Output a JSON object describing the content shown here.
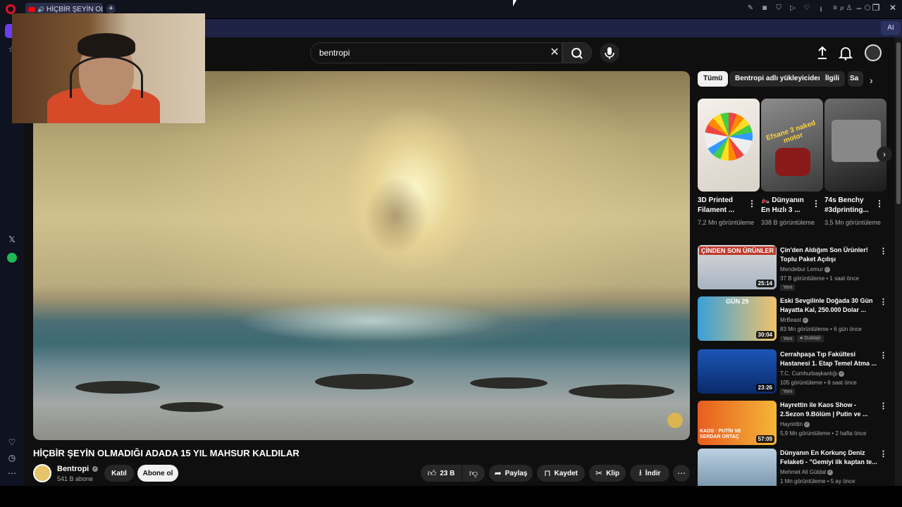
{
  "browser": {
    "tab_title": "HİÇBİR ŞEYİN OLMADI",
    "new_tab_icon": "plus-icon",
    "ai_label": "AI"
  },
  "search": {
    "value": "bentropi"
  },
  "video": {
    "title": "HİÇBİR ŞEYİN OLMADIĞI ADADA 15 YIL MAHSUR KALDILAR",
    "channel_name": "Bentropi",
    "subscribers": "541 B abone",
    "join_label": "Katıl",
    "subscribe_label": "Abone ol",
    "likes": "23 B",
    "share_label": "Paylaş",
    "save_label": "Kaydet",
    "clip_label": "Klip",
    "download_label": "İndir"
  },
  "chips": [
    "Tümü",
    "Bentropi adlı yükleyiciden",
    "İlgili",
    "Sa"
  ],
  "shorts": [
    {
      "title": "3D Printed Filament ...",
      "views": "7,2 Mn görüntüleme"
    },
    {
      "title": "🏍️ Dünyanın En Hızlı 3 ...",
      "views": "338 B görüntüleme"
    },
    {
      "title": "74s Benchy #3dprinting...",
      "views": "3,5 Mn görüntüleme"
    }
  ],
  "shorts_thumb_text": {
    "1": "Efsane 3 naked motor"
  },
  "recommendations": [
    {
      "title": "Çin'den Aldığım Son Ürünler! Toplu Paket Açılışı",
      "channel": "Mendebur Lemur",
      "meta": "37 B görüntüleme • 1 saat önce",
      "duration": "25:14",
      "badge": "Yeni",
      "thumb_text": "ÇİNDEN SON ÜRÜNLER"
    },
    {
      "title": "Eski Sevgilinle Doğada 30 Gün Hayatta Kal, 250.000 Dolar ...",
      "channel": "MrBeast",
      "meta": "83 Mn görüntüleme • 6 gün önce",
      "duration": "30:04",
      "badge": "Yeni",
      "badge2": "Dublajlı",
      "thumb_text": "GÜN 29"
    },
    {
      "title": "Cerrahpaşa Tıp Fakültesi Hastanesi 1. Etap Temel Atma ...",
      "channel": "T.C. Cumhurbaşkanlığı",
      "meta": "105 görüntüleme • 8 saat önce",
      "duration": "23:26",
      "badge": "Yeni",
      "thumb_text": ""
    },
    {
      "title": "Hayrettin ile Kaos Show - 2.Sezon 9.Bölüm | Putin ve ...",
      "channel": "Hayrettin",
      "meta": "5,9 Mn görüntüleme • 2 hafta önce",
      "duration": "57:09",
      "thumb_text": "KAOS · PUTİN VE SERDAR ORTAÇ"
    },
    {
      "title": "Dünyanın En Korkunç Deniz Felaketi - \"Gemiyi ilk kaptan te...",
      "channel": "Mehmet Ali Güldal",
      "meta": "1 Mn görüntüleme • 5 ay önce",
      "thumb_text": ""
    }
  ],
  "colors": {
    "accent": "#ff0000",
    "page_bg": "#0f0f0f",
    "chip_bg": "#272727"
  }
}
